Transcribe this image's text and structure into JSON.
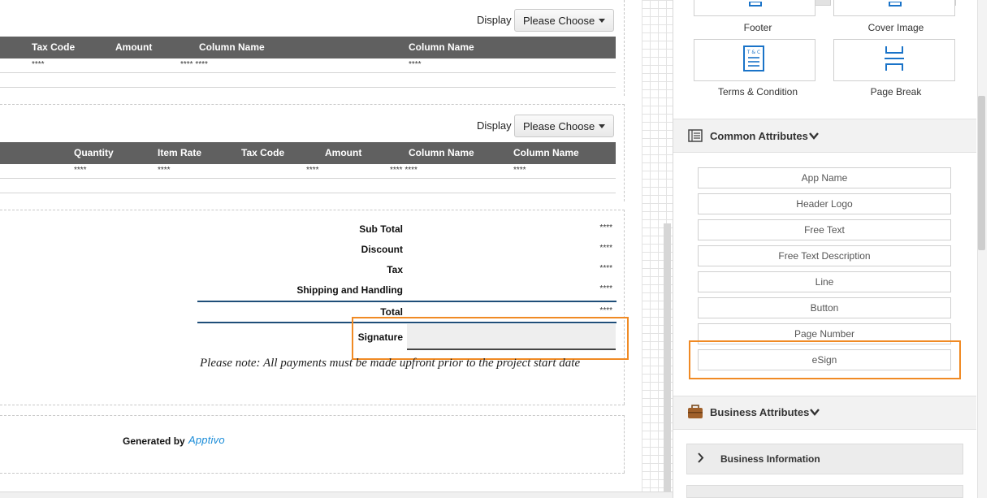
{
  "canvas": {
    "display_label": "Display",
    "choose_label": "Please Choose",
    "table1": {
      "headers": [
        "Tax Code",
        "Amount",
        "Column Name",
        "Column Name"
      ],
      "cells": [
        "****",
        "**** ****",
        "****"
      ]
    },
    "table2": {
      "headers": [
        "Quantity",
        "Item Rate",
        "Tax Code",
        "Amount",
        "Column Name",
        "Column Name"
      ],
      "cells": [
        "****",
        "****",
        "****",
        "**** ****",
        "****"
      ]
    },
    "summary": {
      "sub_total": "Sub Total",
      "discount": "Discount",
      "tax": "Tax",
      "shipping": "Shipping and Handling",
      "total": "Total",
      "masked": "****"
    },
    "signature_label": "Signature",
    "note": "Please note: All payments must be made upfront prior to the project start date",
    "generated_by": "Generated by",
    "brand": "Apptivo"
  },
  "panel": {
    "tiles": {
      "footer": "Footer",
      "cover_image": "Cover Image",
      "terms": "Terms & Condition",
      "page_break": "Page Break",
      "terms_icon_text": "T & C"
    },
    "common_attributes": {
      "title": "Common Attributes",
      "items": [
        "App Name",
        "Header Logo",
        "Free Text",
        "Free Text Description",
        "Line",
        "Button",
        "Page Number",
        "eSign"
      ]
    },
    "business_attributes": {
      "title": "Business Attributes",
      "items": [
        "Business Information"
      ]
    }
  },
  "colors": {
    "highlight": "#f08a24",
    "header_bg": "#606060",
    "total_rule": "#1f4e79",
    "brand": "#1a8cd8"
  }
}
